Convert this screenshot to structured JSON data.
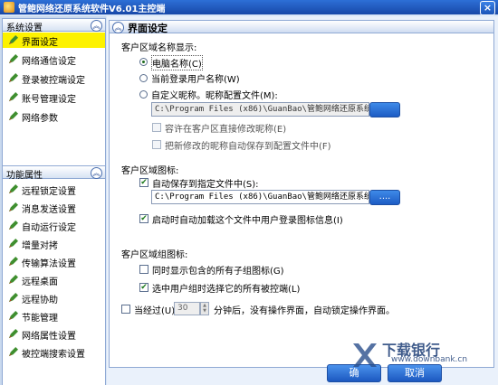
{
  "window": {
    "title": "管鲍网络还原系统软件V6.01主控端",
    "close_label": "×"
  },
  "sidebar": {
    "group1": {
      "title": "系统设置",
      "chevron": "︽",
      "items": [
        {
          "label": "界面设定"
        },
        {
          "label": "网络通信设定"
        },
        {
          "label": "登录被控端设定"
        },
        {
          "label": "账号管理设定"
        },
        {
          "label": "网络参数"
        }
      ]
    },
    "group2": {
      "title": "功能属性",
      "chevron": "︽",
      "items": [
        {
          "label": "远程锁定设置"
        },
        {
          "label": "消息发送设置"
        },
        {
          "label": "自动运行设定"
        },
        {
          "label": "增量对拷"
        },
        {
          "label": "传输算法设置"
        },
        {
          "label": "远程桌面"
        },
        {
          "label": "远程协助"
        },
        {
          "label": "节能管理"
        },
        {
          "label": "网络属性设置"
        },
        {
          "label": "被控端搜索设置"
        }
      ]
    }
  },
  "section": {
    "title": "界面设定",
    "chevron": "︽"
  },
  "client_name": {
    "heading": "客户区域名称显示:",
    "opt_computer": "电脑名称(C)",
    "opt_user": "当前登录用户名称(W)",
    "opt_custom": "自定义昵称。昵称配置文件(M):",
    "path": "C:\\Program Files (x86)\\GuanBao\\管鲍网络还原系统软件",
    "allow_edit": "容许在客户区直接修改昵称(E)",
    "auto_save": "把新修改的昵称自动保存到配置文件中(F)"
  },
  "client_icon": {
    "heading": "客户区域图标:",
    "auto_save": "自动保存到指定文件中(S):",
    "path": "C:\\Program Files (x86)\\GuanBao\\管鲍网络还原系统软件",
    "browse_label": "....",
    "auto_load": "启动时自动加载这个文件中用户登录图标信息(I)"
  },
  "group_icon": {
    "heading": "客户区域组图标:",
    "show_all": "同时显示包含的所有子组图标(G)",
    "select_all": "选中用户组时选择它的所有被控端(L)"
  },
  "idle": {
    "prefix": "当经过(U)",
    "value": "30",
    "suffix": "分钟后，没有操作界面，自动锁定操作界面。"
  },
  "buttons": {
    "ok": "确",
    "cancel": "取消"
  },
  "watermark": {
    "brand": "下载银行",
    "url": "www.downbank.cn"
  }
}
